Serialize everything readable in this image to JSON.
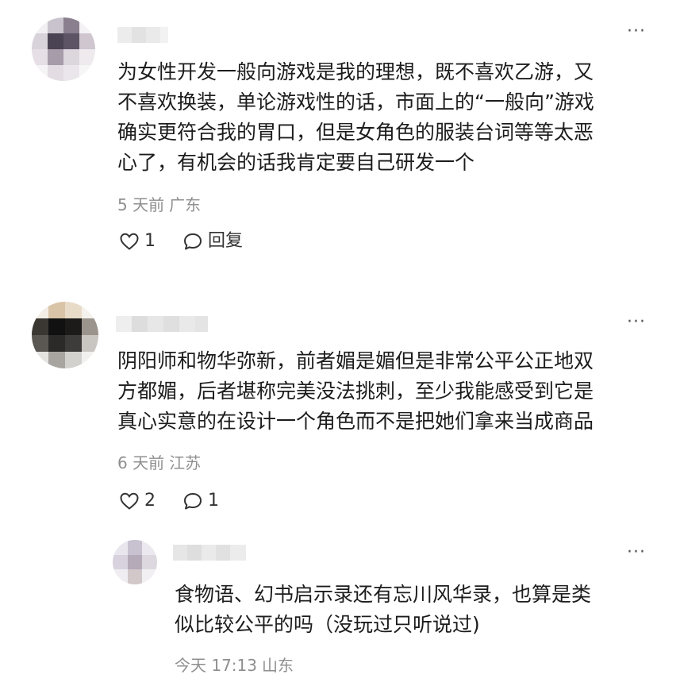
{
  "comments": [
    {
      "lines": [
        "为女性开发一般向游戏是我的理想，既不喜欢乙游，又",
        "不喜欢换装，单论游戏性的话，市面上的“一般向”游戏",
        "确实更符合我的胃口，但是女角色的服装台词等等太恶",
        "心了，有机会的话我肯定要自己研发一个"
      ],
      "time": "5 天前",
      "location": "广东",
      "like_count": "1",
      "reply_label": "回复"
    },
    {
      "lines": [
        "阴阳师和物华弥新，前者媚是媚但是非常公平公正地双",
        "方都媚，后者堪称完美没法挑刺，至少我能感受到它是",
        "真心实意的在设计一个角色而不是把她们拿来当成商品"
      ],
      "time": "6 天前",
      "location": "江苏",
      "like_count": "2",
      "reply_count": "1"
    }
  ],
  "reply": {
    "lines": [
      "食物语、幻书启示录还有忘川风华录，也算是类",
      "似比较公平的吗（没玩过只听说过)"
    ],
    "time": "今天 17:13",
    "location": "山东"
  },
  "more_glyph": "···",
  "icons": {
    "like": "heart-outline-icon",
    "comment": "speech-bubble-icon",
    "more": "more-horizontal-icon"
  }
}
